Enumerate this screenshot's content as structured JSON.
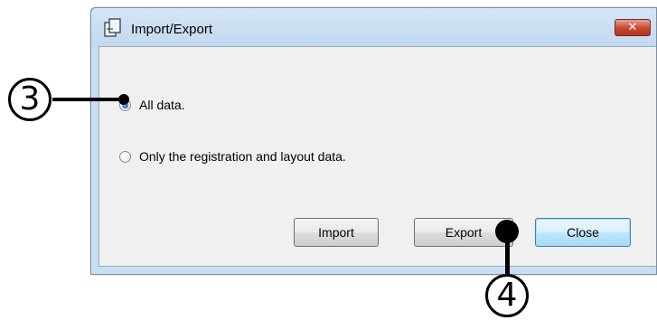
{
  "window": {
    "title": "Import/Export",
    "close_glyph": "✕"
  },
  "options": [
    {
      "label": "All data.",
      "checked": true
    },
    {
      "label": "Only the registration and layout data.",
      "checked": false
    }
  ],
  "buttons": {
    "import_label": "Import",
    "export_label": "Export",
    "close_label": "Close"
  },
  "annotations": {
    "callout_3": "3",
    "callout_4": "4"
  },
  "icons": {
    "title": "import-export-icon",
    "close": "close-icon"
  }
}
